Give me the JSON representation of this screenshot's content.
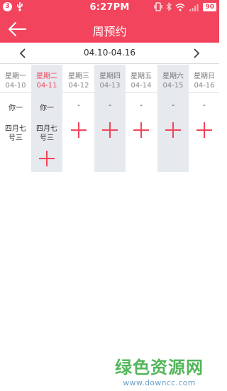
{
  "status_bar": {
    "notification_count": "3",
    "time": "6:27PM",
    "battery": "90",
    "icons": [
      "notification-badge",
      "usb-icon",
      "vibrate-icon",
      "bluetooth-icon",
      "wifi-icon",
      "signal-icon",
      "battery-icon"
    ]
  },
  "header": {
    "title": "周预约",
    "back_icon": "back-arrow-icon"
  },
  "week_nav": {
    "range": "04.10-04.16",
    "prev_icon": "chevron-left-icon",
    "next_icon": "chevron-right-icon"
  },
  "days": [
    {
      "name": "星期一",
      "date": "04-10",
      "slot1": "你一",
      "slot2": "四月七号三",
      "add_slot1": false,
      "add_slot2": false,
      "add_extra": false,
      "shaded": false,
      "selected": false
    },
    {
      "name": "星期二",
      "date": "04-11",
      "slot1": "你一",
      "slot2": "四月七号三",
      "add_slot1": false,
      "add_slot2": false,
      "add_extra": true,
      "shaded": true,
      "selected": true
    },
    {
      "name": "星期三",
      "date": "04-12",
      "slot1": "-",
      "slot2": "",
      "add_slot1": false,
      "add_slot2": true,
      "add_extra": false,
      "shaded": false,
      "selected": false
    },
    {
      "name": "星期四",
      "date": "04-13",
      "slot1": "-",
      "slot2": "",
      "add_slot1": false,
      "add_slot2": true,
      "add_extra": false,
      "shaded": true,
      "selected": false
    },
    {
      "name": "星期五",
      "date": "04-14",
      "slot1": "-",
      "slot2": "",
      "add_slot1": false,
      "add_slot2": true,
      "add_extra": false,
      "shaded": false,
      "selected": false
    },
    {
      "name": "星期六",
      "date": "04-15",
      "slot1": "-",
      "slot2": "",
      "add_slot1": false,
      "add_slot2": true,
      "add_extra": false,
      "shaded": true,
      "selected": false
    },
    {
      "name": "星期日",
      "date": "04-16",
      "slot1": "-",
      "slot2": "",
      "add_slot1": false,
      "add_slot2": true,
      "add_extra": false,
      "shaded": false,
      "selected": false
    }
  ],
  "watermark": {
    "main": "绿色资源网",
    "sub": "www.downcc.com"
  },
  "colors": {
    "accent": "#f2445c",
    "shaded_column": "#e6e9ee",
    "watermark_green": "#53b65a",
    "watermark_blue": "#6aa0c8"
  }
}
